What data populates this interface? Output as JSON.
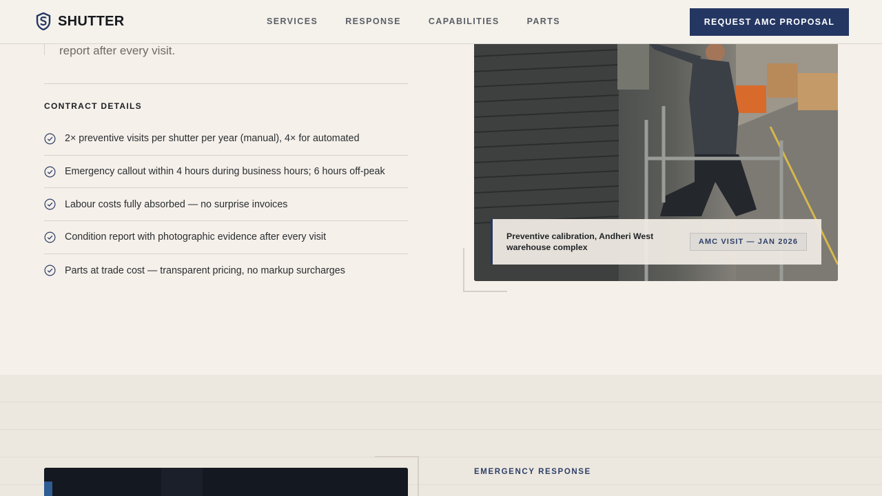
{
  "brand": {
    "name": "SHUTTER",
    "icon": "shield-s-logo-icon"
  },
  "nav": {
    "items": [
      "SERVICES",
      "RESPONSE",
      "CAPABILITIES",
      "PARTS"
    ],
    "cta": "REQUEST AMC PROPOSAL"
  },
  "intro": {
    "tail_text": "report after every visit."
  },
  "contract": {
    "heading": "CONTRACT DETAILS",
    "items": [
      "2× preventive visits per shutter per year (manual), 4× for automated",
      "Emergency callout within 4 hours during business hours; 6 hours off-peak",
      "Labour costs fully absorbed — no surprise invoices",
      "Condition report with photographic evidence after every visit",
      "Parts at trade cost — transparent pricing, no markup surcharges"
    ]
  },
  "photo": {
    "caption": "Preventive calibration, Andheri West warehouse complex",
    "badge": "AMC VISIT — JAN 2026"
  },
  "emergency": {
    "label": "EMERGENCY RESPONSE"
  },
  "colors": {
    "accent": "#243763",
    "background": "#f5f0ea",
    "lower_background": "#ede8df"
  }
}
